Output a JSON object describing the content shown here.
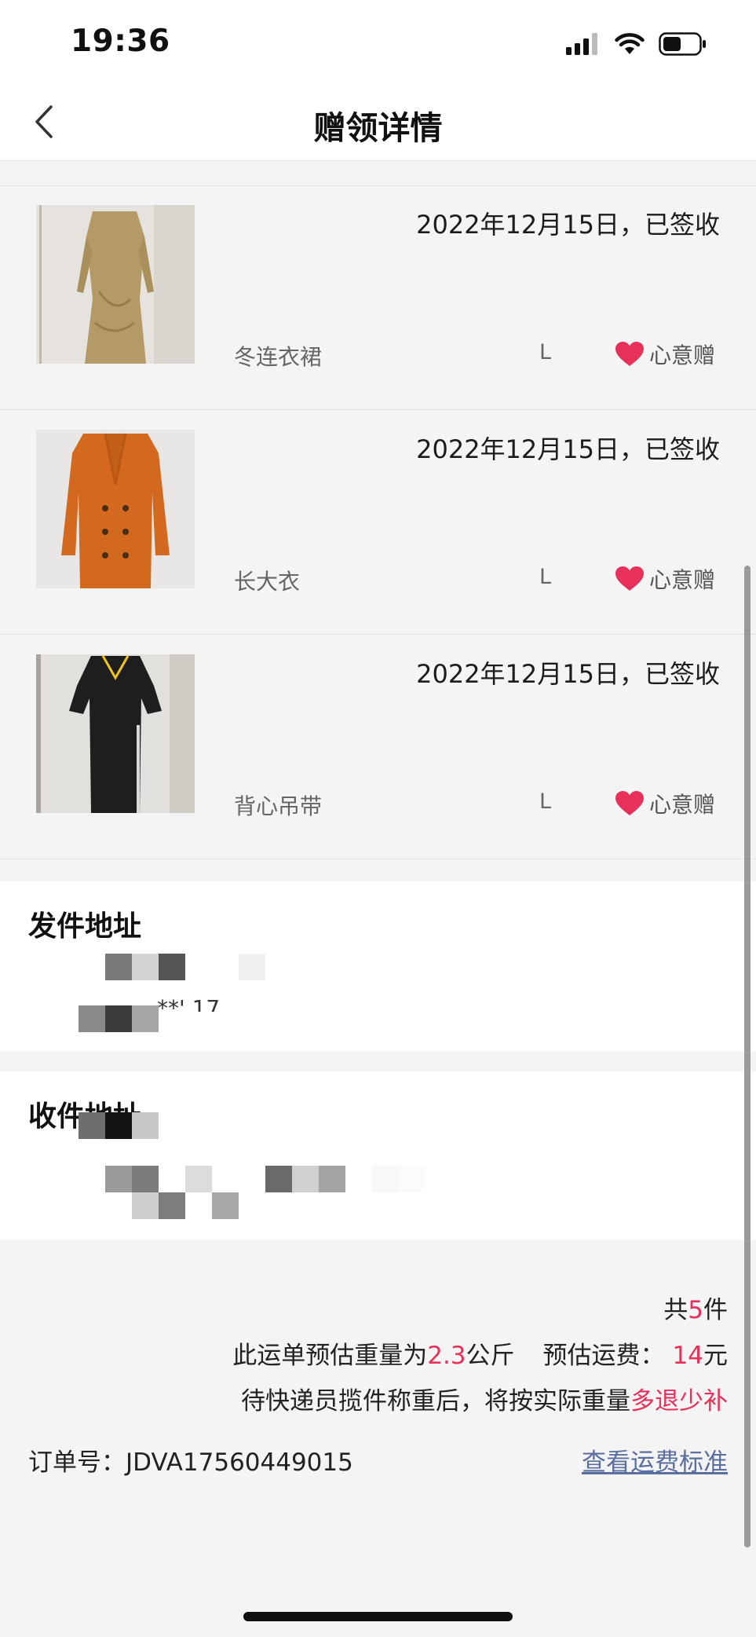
{
  "status_bar": {
    "time": "19:36"
  },
  "nav": {
    "title": "赠领详情"
  },
  "items": [
    {
      "name": "冬连衣裙",
      "date_status": "2022年12月15日，已签收",
      "size": "L",
      "tag": "心意赠"
    },
    {
      "name": "长大衣",
      "date_status": "2022年12月15日，已签收",
      "size": "L",
      "tag": "心意赠"
    },
    {
      "name": "背心吊带",
      "date_status": "2022年12月15日，已签收",
      "size": "L",
      "tag": "心意赠"
    }
  ],
  "sender": {
    "title": "发件地址",
    "partial_text": "**' 17"
  },
  "receiver": {
    "title": "收件地址"
  },
  "summary": {
    "count_prefix": "共",
    "count": "5",
    "count_suffix": "件",
    "weight_prefix": "此运单预估重量为",
    "weight": "2.3",
    "weight_unit": "公斤",
    "fee_label": "预估运费：",
    "fee": "14",
    "fee_unit": "元",
    "note_prefix": "待快递员揽件称重后，将按实际重量",
    "note_highlight": "多退少补",
    "order_label": "订单号：",
    "order_number": "JDVA17560449015",
    "fee_standard_link": "查看运费标准"
  },
  "colors": {
    "accent_red": "#e8315a",
    "link_blue": "#5a6fa0",
    "heart": "#e8315a"
  }
}
